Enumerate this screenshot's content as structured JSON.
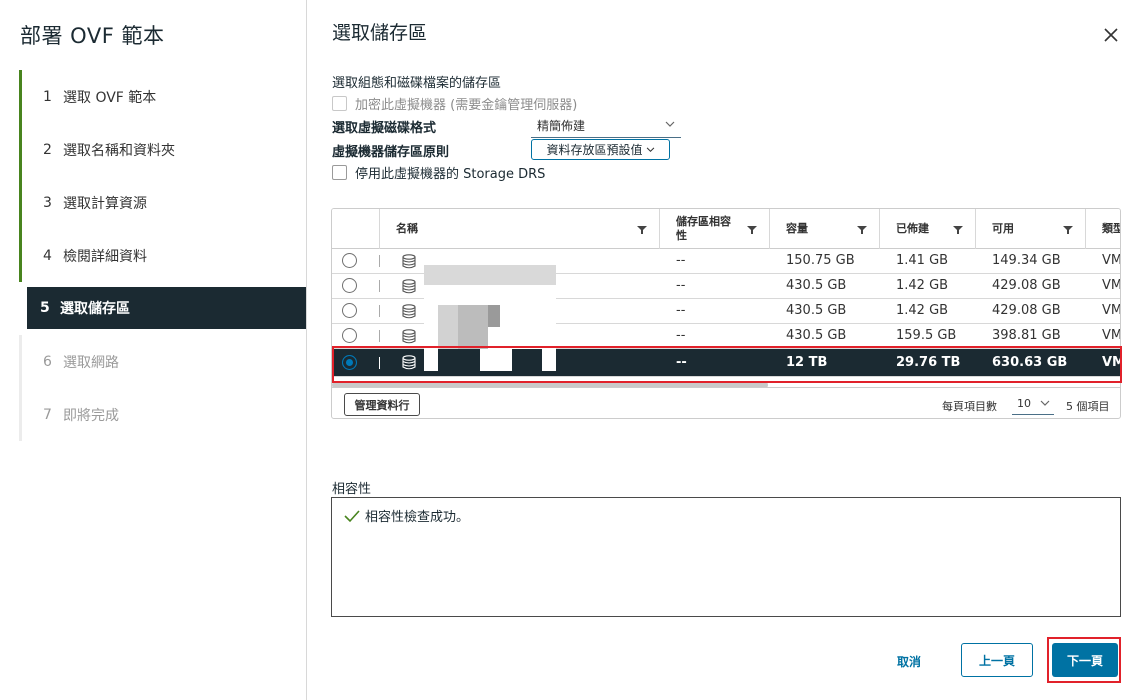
{
  "wizard": {
    "title": "部署 OVF 範本",
    "steps": [
      {
        "num": "1",
        "label": "選取 OVF 範本",
        "state": "done"
      },
      {
        "num": "2",
        "label": "選取名稱和資料夾",
        "state": "done"
      },
      {
        "num": "3",
        "label": "選取計算資源",
        "state": "done"
      },
      {
        "num": "4",
        "label": "檢閱詳細資料",
        "state": "done"
      },
      {
        "num": "5",
        "label": "選取儲存區",
        "state": "active"
      },
      {
        "num": "6",
        "label": "選取網路",
        "state": "future"
      },
      {
        "num": "7",
        "label": "即將完成",
        "state": "future"
      }
    ]
  },
  "page": {
    "title": "選取儲存區",
    "subtitle": "選取組態和磁碟檔案的儲存區",
    "encrypt_label": "加密此虛擬機器 (需要金鑰管理伺服器)",
    "disk_format_label": "選取虛擬磁碟格式",
    "disk_format_value": "精簡佈建",
    "policy_label": "虛擬機器儲存區原則",
    "policy_value": "資料存放區預設值",
    "drs_label": "停用此虛擬機器的 Storage DRS"
  },
  "table": {
    "headers": {
      "name": "名稱",
      "compat": "儲存區相容性",
      "capacity": "容量",
      "provisioned": "已佈建",
      "free": "可用",
      "type": "類型"
    },
    "rows": [
      {
        "compat": "--",
        "capacity": "150.75 GB",
        "provisioned": "1.41 GB",
        "free": "149.34 GB",
        "type": "VM"
      },
      {
        "compat": "--",
        "capacity": "430.5 GB",
        "provisioned": "1.42 GB",
        "free": "429.08 GB",
        "type": "VM"
      },
      {
        "compat": "--",
        "capacity": "430.5 GB",
        "provisioned": "1.42 GB",
        "free": "429.08 GB",
        "type": "VM"
      },
      {
        "compat": "--",
        "capacity": "430.5 GB",
        "provisioned": "159.5 GB",
        "free": "398.81 GB",
        "type": "VM"
      },
      {
        "compat": "--",
        "capacity": "12 TB",
        "provisioned": "29.76 TB",
        "free": "630.63 GB",
        "type": "VM"
      }
    ],
    "manage_columns": "管理資料行",
    "per_page_label": "每頁項目數",
    "per_page_value": "10",
    "item_count": "5 個項目"
  },
  "compat": {
    "label": "相容性",
    "message": "相容性檢查成功。"
  },
  "buttons": {
    "cancel": "取消",
    "back": "上一頁",
    "next": "下一頁"
  }
}
